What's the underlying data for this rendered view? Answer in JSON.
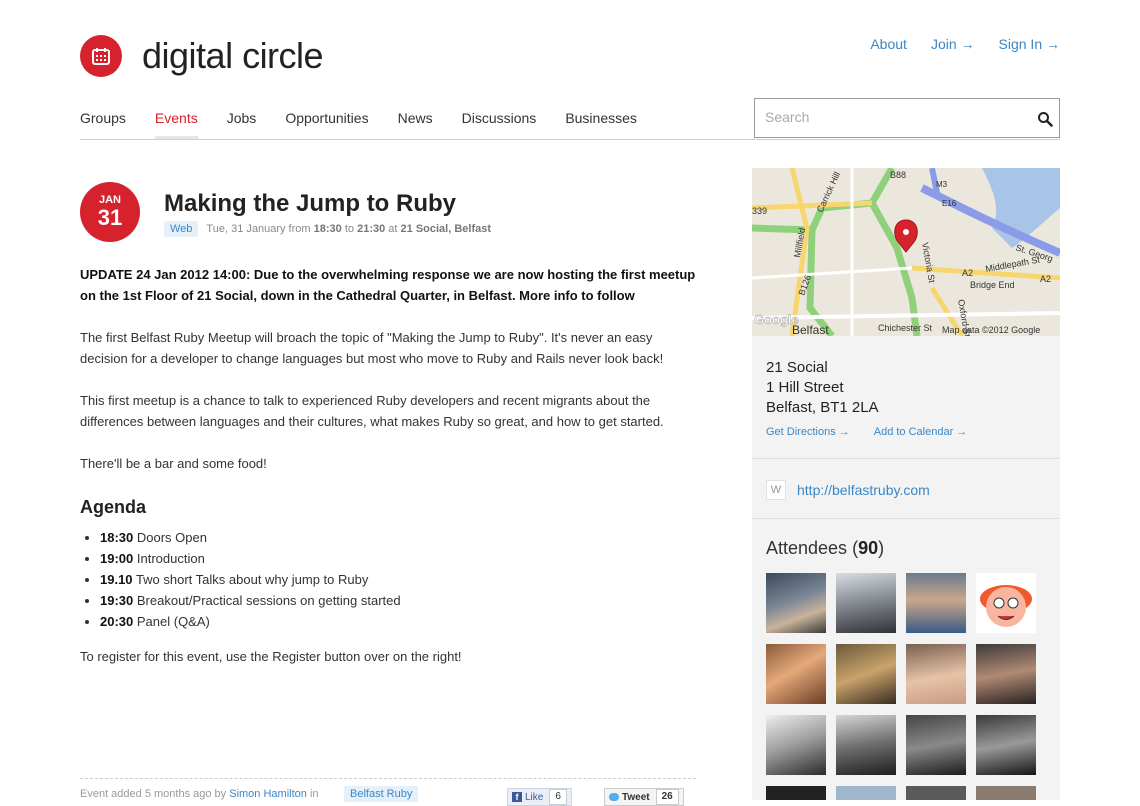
{
  "header": {
    "logo_text": "digital circle",
    "links": [
      "About",
      "Join →",
      "Sign In →"
    ]
  },
  "nav": {
    "items": [
      "Groups",
      "Events",
      "Jobs",
      "Opportunities",
      "News",
      "Discussions",
      "Businesses"
    ],
    "active": "Events",
    "search_placeholder": "Search"
  },
  "event": {
    "month": "JAN",
    "day": "31",
    "title": "Making the Jump to Ruby",
    "tag": "Web",
    "date_text": "Tue, 31 January from",
    "start": "18:30",
    "to": "to",
    "end": "21:30",
    "at": "at",
    "venue_short": "21 Social, Belfast"
  },
  "content": {
    "update": "UPDATE 24 Jan 2012 14:00: Due to the overwhelming response we are now hosting the first meetup on the 1st Floor of 21 Social, down in the Cathedral Quarter, in Belfast. More info to follow",
    "p1": "The first Belfast Ruby Meetup will broach the topic of \"Making the Jump to Ruby\". It's never an easy decision for a developer to change languages but most who move to Ruby and Rails never look back!",
    "p2": "This first meetup is a chance to talk to experienced Ruby developers and recent migrants about the differences between languages and their cultures, what makes Ruby so great, and how to get started.",
    "p3": "There'll be a bar and some food!",
    "agenda_title": "Agenda",
    "agenda": [
      {
        "time": "18:30",
        "text": "Doors Open"
      },
      {
        "time": "19:00",
        "text": "Introduction"
      },
      {
        "time": "19.10",
        "text": "Two short Talks about why jump to Ruby"
      },
      {
        "time": "19:30",
        "text": "Breakout/Practical sessions on getting started"
      },
      {
        "time": "20:30",
        "text": "Panel (Q&A)"
      }
    ],
    "register": "To register for this event, use the Register button over on the right!"
  },
  "footer": {
    "added_text": "Event added 5 months ago by",
    "author": "Simon Hamilton",
    "in": "in",
    "group": "Belfast Ruby",
    "like_label": "Like",
    "like_count": "6",
    "tweet_label": "Tweet",
    "tweet_count": "26"
  },
  "sidebar": {
    "map": {
      "labels": [
        "B88",
        "M3",
        "339",
        "Carrick Hill",
        "E16",
        "St. Georg",
        "Millfield",
        "Victoria St",
        "A2",
        "Middlepath St",
        "A2",
        "Bridge End",
        "B126",
        "Oxford St",
        "Belfast",
        "Chichester St",
        "Map data ©2012 Google",
        "Google"
      ]
    },
    "venue_name": "21 Social",
    "venue_street": "1 Hill Street",
    "venue_city": "Belfast, BT1 2LA",
    "directions": "Get Directions →",
    "calendar": "Add to Calendar →",
    "website_icon": "W",
    "website": "http://belfastruby.com",
    "attendees_label": "Attendees (",
    "attendees_count": "90",
    "attendees_close": ")"
  },
  "colors": {
    "brand_red": "#d5222d",
    "link_blue": "#3a87c8"
  }
}
